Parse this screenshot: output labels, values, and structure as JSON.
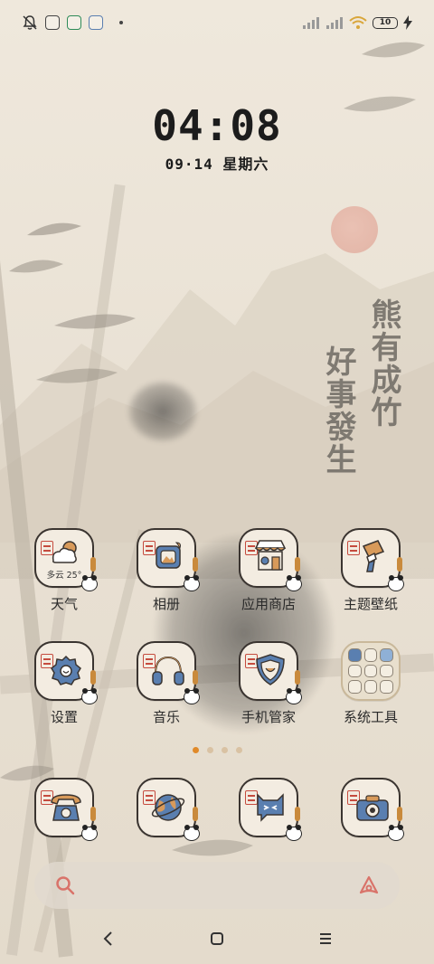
{
  "status_bar": {
    "battery": "10",
    "icons": [
      "bell-off-icon",
      "gallery-notif-icon",
      "wechat-notif-icon",
      "app-notif-icon",
      "more-dot-icon",
      "signal-1-icon",
      "signal-2-icon",
      "wifi-icon",
      "battery-icon",
      "charging-icon"
    ]
  },
  "clock": {
    "time": "04:08",
    "date": "09·14 星期六"
  },
  "wallpaper": {
    "calligraphy_left": "好事發生",
    "calligraphy_right": "熊有成竹"
  },
  "apps": [
    {
      "label": "天气",
      "icon": "weather-icon",
      "weather_text": "多云 25°"
    },
    {
      "label": "相册",
      "icon": "gallery-icon"
    },
    {
      "label": "应用商店",
      "icon": "app-store-icon"
    },
    {
      "label": "主题壁纸",
      "icon": "theme-brush-icon"
    },
    {
      "label": "设置",
      "icon": "settings-gear-icon"
    },
    {
      "label": "音乐",
      "icon": "headphones-icon"
    },
    {
      "label": "手机管家",
      "icon": "shield-icon"
    },
    {
      "label": "系统工具",
      "icon": "folder-icon"
    }
  ],
  "dock": [
    {
      "icon": "phone-icon"
    },
    {
      "icon": "browser-globe-icon"
    },
    {
      "icon": "messages-icon"
    },
    {
      "icon": "camera-icon"
    }
  ],
  "pages": {
    "count": 4,
    "active": 0
  },
  "colors": {
    "accent": "#e08a2a",
    "seal_red": "#c54b3e",
    "icon_blue": "#5a7fb0",
    "icon_orange": "#d89a5a"
  }
}
